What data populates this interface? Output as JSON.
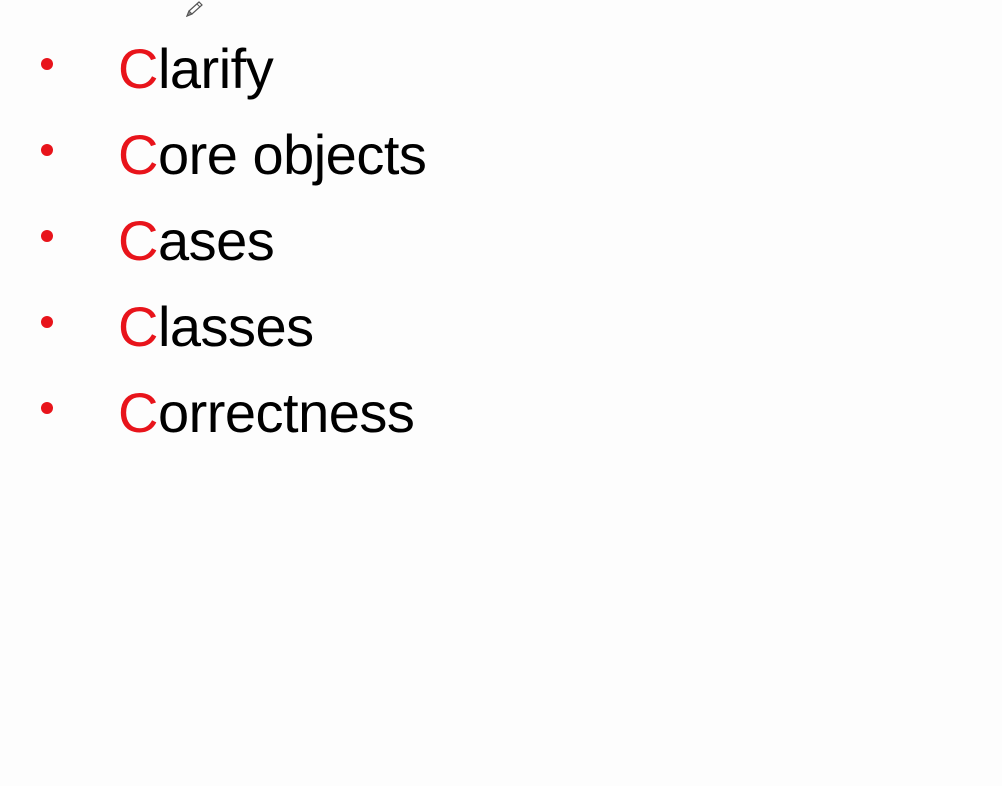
{
  "colors": {
    "accent": "#e8141b",
    "text": "#000000",
    "bullet": "#e8141b",
    "background": "#fdfdfd"
  },
  "cursor": {
    "icon": "pen-cursor-icon"
  },
  "bullets": [
    {
      "first_letter": "C",
      "rest": "larify"
    },
    {
      "first_letter": "C",
      "rest": "ore objects"
    },
    {
      "first_letter": "C",
      "rest": "ases"
    },
    {
      "first_letter": "C",
      "rest": "lasses"
    },
    {
      "first_letter": "C",
      "rest": "orrectness"
    }
  ]
}
